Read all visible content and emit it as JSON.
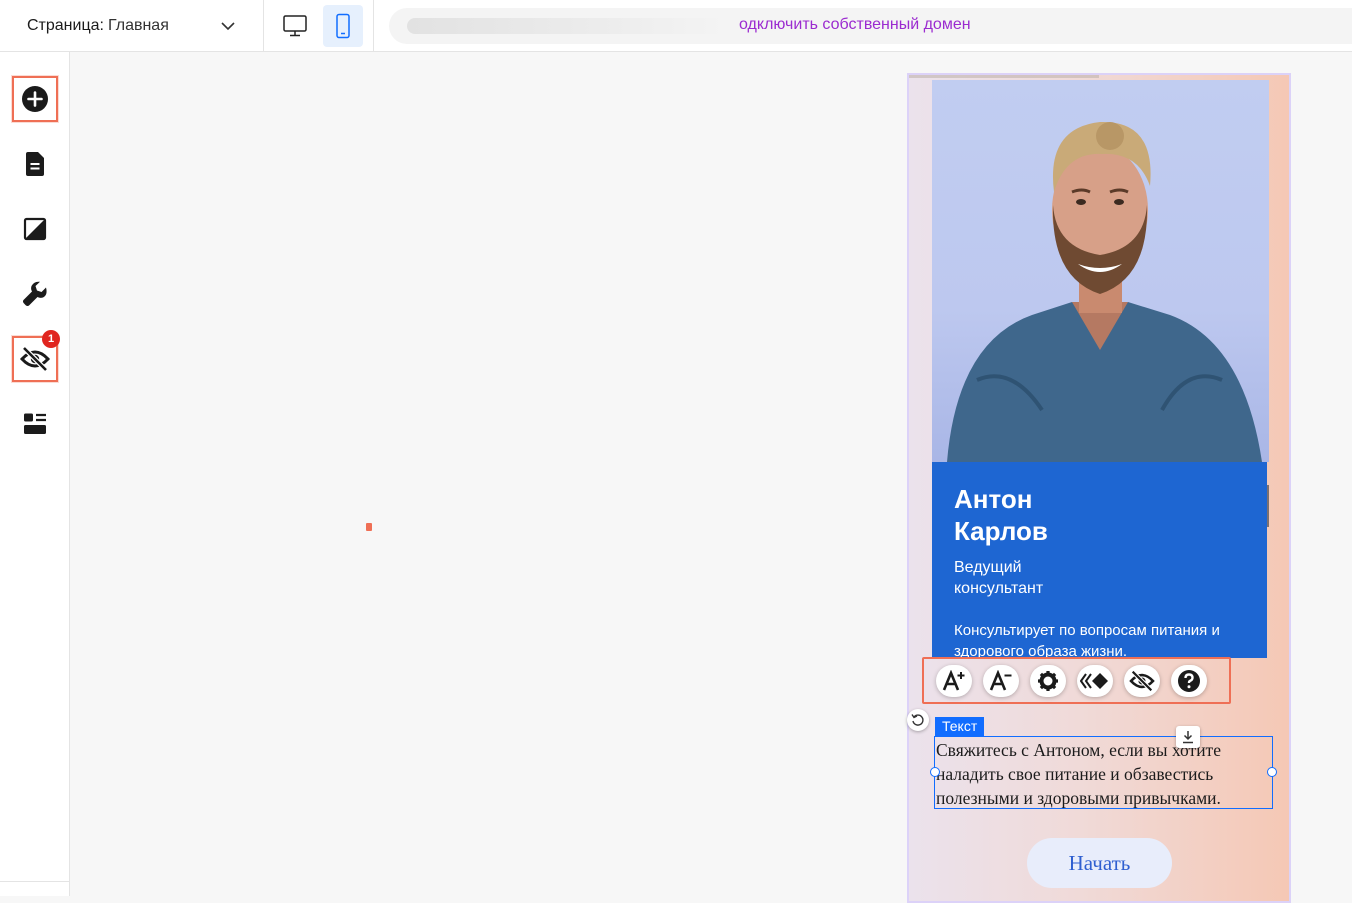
{
  "topbar": {
    "page_label": "Страница:",
    "page_value": "Главная",
    "devices": [
      {
        "name": "desktop",
        "icon": "desktop-icon",
        "active": false
      },
      {
        "name": "mobile",
        "icon": "mobile-icon",
        "active": true
      }
    ],
    "url_link": "одключить собственный домен"
  },
  "sidebar": {
    "items": [
      {
        "name": "add-elements",
        "icon": "plus-circle-icon",
        "highlighted": true
      },
      {
        "name": "pages",
        "icon": "page-icon",
        "highlighted": false
      },
      {
        "name": "design",
        "icon": "theme-icon",
        "highlighted": false
      },
      {
        "name": "tools",
        "icon": "wrench-icon",
        "highlighted": false
      },
      {
        "name": "hidden-elements",
        "icon": "eye-slash-icon",
        "highlighted": true,
        "badge": "1"
      },
      {
        "name": "layout",
        "icon": "layout-icon",
        "highlighted": false
      }
    ]
  },
  "profile": {
    "name": "Антон\nКарлов",
    "role": "Ведущий\nконсультант",
    "description": "Консультирует по вопросам питания и здорового образа жизни."
  },
  "element_toolbar": {
    "buttons": [
      {
        "name": "increase-font",
        "icon": "font-increase-icon"
      },
      {
        "name": "decrease-font",
        "icon": "font-decrease-icon"
      },
      {
        "name": "settings",
        "icon": "gear-icon"
      },
      {
        "name": "animation",
        "icon": "animation-icon"
      },
      {
        "name": "hide",
        "icon": "eye-slash-icon"
      },
      {
        "name": "help",
        "icon": "help-icon"
      }
    ]
  },
  "selection": {
    "tag": "Текст",
    "text": "Свяжитесь с Антоном, если вы хотите наладить свое питание и обзавестись полезными и здоровыми привычками."
  },
  "cta_button": "Начать",
  "colors": {
    "accent_blue": "#116dff",
    "card_blue": "#1e66d2",
    "highlight": "#ef6f55",
    "badge": "#e0251f",
    "link": "#9b2bd0"
  }
}
